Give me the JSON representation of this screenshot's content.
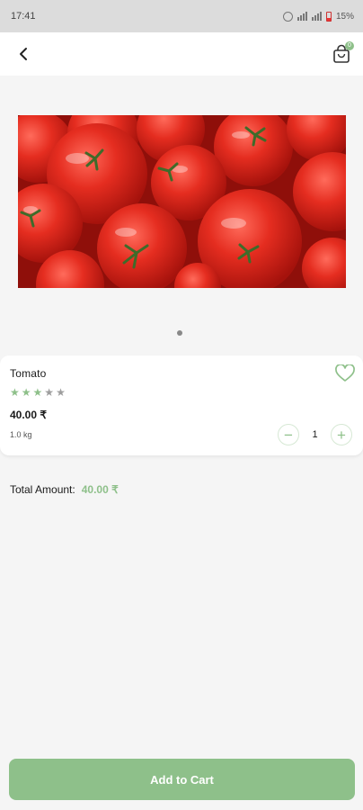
{
  "status_bar": {
    "time": "17:41",
    "battery": "15%"
  },
  "header": {
    "back_icon": "chevron-left-icon",
    "cart_icon": "shopping-bag-icon",
    "cart_count": "0"
  },
  "gallery": {
    "image": "tomatoes-photo",
    "pages": 1,
    "active_page": 1
  },
  "product": {
    "name": "Tomato",
    "rating": 3,
    "rating_max": 5,
    "price": "40.00 ₹",
    "unit": "1.0 kg",
    "quantity": "1"
  },
  "summary": {
    "label": "Total Amount:",
    "amount": "40.00 ₹"
  },
  "actions": {
    "add_to_cart": "Add to Cart"
  },
  "colors": {
    "accent": "#8ec08a",
    "star_off": "#9e9e9e",
    "background": "#f5f5f5"
  }
}
